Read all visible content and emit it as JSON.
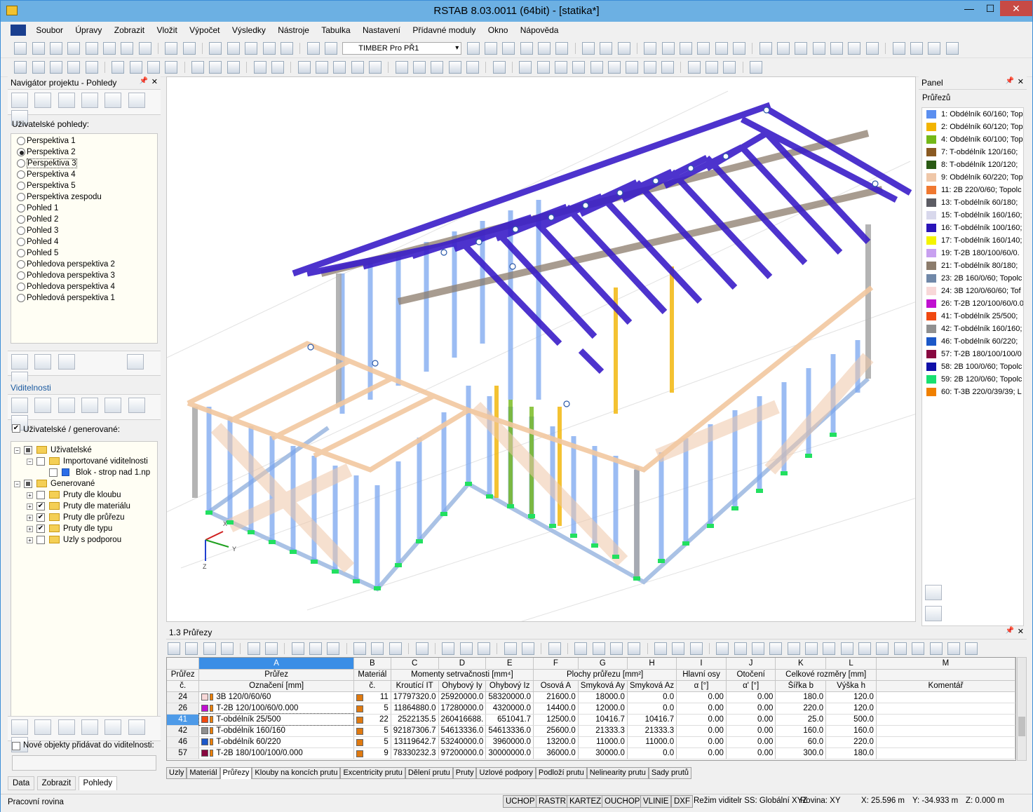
{
  "app": {
    "title": "RSTAB 8.03.0011 (64bit) - [statika*]"
  },
  "window_controls": {
    "minimize": "—",
    "maximize": "☐",
    "close": "✕"
  },
  "menu": [
    "Soubor",
    "Úpravy",
    "Zobrazit",
    "Vložit",
    "Výpočet",
    "Výsledky",
    "Nástroje",
    "Tabulka",
    "Nastavení",
    "Přídavné moduly",
    "Okno",
    "Nápověda"
  ],
  "toolbar": {
    "module_combo": "TIMBER Pro PŘ1"
  },
  "navigator": {
    "title": "Navigátor projektu - Pohledy",
    "user_views_label": "Uživatelské pohledy:",
    "views": [
      {
        "label": "Perspektiva 1",
        "checked": false
      },
      {
        "label": "Perspektiva 2",
        "checked": true
      },
      {
        "label": "Perspektiva 3",
        "checked": false,
        "focus": true
      },
      {
        "label": "Perspektiva 4",
        "checked": false
      },
      {
        "label": "Perspektiva 5",
        "checked": false
      },
      {
        "label": "Perspektiva zespodu",
        "checked": false
      },
      {
        "label": "Pohled 1",
        "checked": false
      },
      {
        "label": "Pohled 2",
        "checked": false
      },
      {
        "label": "Pohled 3",
        "checked": false
      },
      {
        "label": "Pohled 4",
        "checked": false
      },
      {
        "label": "Pohled 5",
        "checked": false
      },
      {
        "label": "Pohledova perspektiva 2",
        "checked": false
      },
      {
        "label": "Pohledova perspektiva 3",
        "checked": false
      },
      {
        "label": "Pohledova perspektiva 4",
        "checked": false
      },
      {
        "label": "Pohledová perspektiva 1",
        "checked": false
      }
    ],
    "visibility_title": "Viditelnosti",
    "visibility_check_label": "Uživatelské / generované:",
    "tree": [
      {
        "label": "Uživatelské",
        "level": 0,
        "exp": "−",
        "cb": "part",
        "icon": "folder"
      },
      {
        "label": "Importované viditelnosti",
        "level": 1,
        "exp": "−",
        "cb": "empty",
        "icon": "folder"
      },
      {
        "label": "Blok - strop nad 1.np",
        "level": 2,
        "exp": "",
        "cb": "empty",
        "icon": "block"
      },
      {
        "label": "Generované",
        "level": 0,
        "exp": "−",
        "cb": "part",
        "icon": "folder"
      },
      {
        "label": "Pruty dle kloubu",
        "level": 1,
        "exp": "+",
        "cb": "empty",
        "icon": "folder"
      },
      {
        "label": "Pruty dle materiálu",
        "level": 1,
        "exp": "+",
        "cb": "checked",
        "icon": "folder"
      },
      {
        "label": "Pruty dle průřezu",
        "level": 1,
        "exp": "+",
        "cb": "checked",
        "icon": "folder"
      },
      {
        "label": "Pruty dle typu",
        "level": 1,
        "exp": "+",
        "cb": "checked",
        "icon": "folder"
      },
      {
        "label": "Uzly s podporou",
        "level": 1,
        "exp": "+",
        "cb": "empty",
        "icon": "folder"
      }
    ],
    "new_objects_label": "Nové objekty přidávat do viditelnosti:",
    "tabs": [
      "Data",
      "Zobrazit",
      "Pohledy"
    ],
    "active_tab": "Pohledy"
  },
  "viewport": {
    "axes": {
      "x": "X",
      "y": "Y",
      "z": "Z"
    }
  },
  "panel": {
    "title": "Panel",
    "legend_title": "Průřezů",
    "items": [
      {
        "label": "1: Obdélník 60/160; Top",
        "color": "#5b8ff0"
      },
      {
        "label": "2: Obdélník 60/120; Top",
        "color": "#f2b400"
      },
      {
        "label": "4: Obdélník 60/100; Top",
        "color": "#74b818"
      },
      {
        "label": "7: T-obdélník 120/160; ",
        "color": "#8a5a22"
      },
      {
        "label": "8: T-obdélník 120/120; ",
        "color": "#2a5a14"
      },
      {
        "label": "9: Obdélník 60/220; Top",
        "color": "#efc7a8"
      },
      {
        "label": "11: 2B 220/0/60; Topolc",
        "color": "#f07830"
      },
      {
        "label": "13: T-obdélník 60/180; ",
        "color": "#5c5c64"
      },
      {
        "label": "15: T-obdélník 160/160;",
        "color": "#d8d8ec"
      },
      {
        "label": "16: T-obdélník 100/160;",
        "color": "#2a14b8"
      },
      {
        "label": "17: T-obdélník 160/140;",
        "color": "#f4f400"
      },
      {
        "label": "19: T-2B 180/100/60/0.",
        "color": "#c8a0f0"
      },
      {
        "label": "21: T-obdélník 80/180; ",
        "color": "#8c7c6c"
      },
      {
        "label": "23: 2B 160/0/60; Topolc",
        "color": "#7088a8"
      },
      {
        "label": "24: 3B 120/0/60/60; Tof",
        "color": "#f8d8d8"
      },
      {
        "label": "26: T-2B 120/100/60/0.0",
        "color": "#c010d0"
      },
      {
        "label": "41: T-obdélník 25/500; ",
        "color": "#f04810"
      },
      {
        "label": "42: T-obdélník 160/160;",
        "color": "#909090"
      },
      {
        "label": "46: T-obdélník 60/220; ",
        "color": "#1c58c8"
      },
      {
        "label": "57: T-2B 180/100/100/0",
        "color": "#880840"
      },
      {
        "label": "58: 2B 100/0/60; Topolc",
        "color": "#1010a8"
      },
      {
        "label": "59: 2B 120/0/60; Topolc",
        "color": "#18e070"
      },
      {
        "label": "60: T-3B 220/0/39/39; L",
        "color": "#f08000"
      }
    ]
  },
  "table": {
    "title": "1.3 Průřezy",
    "col_letters": [
      "A",
      "B",
      "C",
      "D",
      "E",
      "F",
      "G",
      "H",
      "I",
      "J",
      "K",
      "L",
      "M"
    ],
    "group_headers": {
      "rowh": "Průřez",
      "A": "Průřez",
      "B": "Materiál",
      "CDE": "Momenty setrvačnosti [mm⁴]",
      "FGH": "Plochy průřezu [mm²]",
      "I": "Hlavní osy",
      "J": "Otočení",
      "KL": "Celkové rozměry [mm]"
    },
    "sub_headers": {
      "rowh": "č.",
      "A": "Označení [mm]",
      "B": "č.",
      "C": "Kroutící IT",
      "D": "Ohybový Iy",
      "E": "Ohybový Iz",
      "F": "Osová A",
      "G": "Smyková Ay",
      "H": "Smyková Az",
      "I": "α [°]",
      "J": "α' [°]",
      "K": "Šířka b",
      "L": "Výška h",
      "M": "Komentář"
    },
    "rows": [
      {
        "no": "24",
        "name": "3B 120/0/60/60",
        "color": "#f8d8d8",
        "mat": "11",
        "It": "17797320.0",
        "Iy": "25920000.0",
        "Iz": "58320000.0",
        "A": "21600.0",
        "Ay": "18000.0",
        "Az": "0.0",
        "alpha": "0.00",
        "alpha2": "0.00",
        "b": "180.0",
        "h": "120.0",
        "comment": ""
      },
      {
        "no": "26",
        "name": "T-2B 120/100/60/0.000",
        "color": "#c010d0",
        "mat": "5",
        "It": "11864880.0",
        "Iy": "17280000.0",
        "Iz": "4320000.0",
        "A": "14400.0",
        "Ay": "12000.0",
        "Az": "0.0",
        "alpha": "0.00",
        "alpha2": "0.00",
        "b": "220.0",
        "h": "120.0",
        "comment": ""
      },
      {
        "no": "41",
        "name": "T-obdélník 25/500",
        "color": "#f04810",
        "mat": "22",
        "It": "2522135.5",
        "Iy": "260416688.",
        "Iz": "651041.7",
        "A": "12500.0",
        "Ay": "10416.7",
        "Az": "10416.7",
        "alpha": "0.00",
        "alpha2": "0.00",
        "b": "25.0",
        "h": "500.0",
        "comment": "",
        "selected": true
      },
      {
        "no": "42",
        "name": "T-obdélník 160/160",
        "color": "#909090",
        "mat": "5",
        "It": "92187306.7",
        "Iy": "54613336.0",
        "Iz": "54613336.0",
        "A": "25600.0",
        "Ay": "21333.3",
        "Az": "21333.3",
        "alpha": "0.00",
        "alpha2": "0.00",
        "b": "160.0",
        "h": "160.0",
        "comment": ""
      },
      {
        "no": "46",
        "name": "T-obdélník 60/220",
        "color": "#1c58c8",
        "mat": "5",
        "It": "13119642.7",
        "Iy": "53240000.0",
        "Iz": "3960000.0",
        "A": "13200.0",
        "Ay": "11000.0",
        "Az": "11000.0",
        "alpha": "0.00",
        "alpha2": "0.00",
        "b": "60.0",
        "h": "220.0",
        "comment": ""
      },
      {
        "no": "57",
        "name": "T-2B 180/100/100/0.000",
        "color": "#880840",
        "mat": "9",
        "It": "78330232.3",
        "Iy": "97200000.0",
        "Iz": "30000000.0",
        "A": "36000.0",
        "Ay": "30000.0",
        "Az": "0.0",
        "alpha": "0.00",
        "alpha2": "0.00",
        "b": "300.0",
        "h": "180.0",
        "comment": ""
      }
    ],
    "sheet_tabs": [
      "Uzly",
      "Materiál",
      "Průřezy",
      "Klouby na koncích prutu",
      "Excentricity prutu",
      "Dělení prutu",
      "Pruty",
      "Uzlové podpory",
      "Podloží prutu",
      "Nelinearity prutu",
      "Sady prutů"
    ],
    "active_sheet": "Průřezy"
  },
  "status": {
    "left": "Pracovní rovina",
    "buttons": [
      "UCHOP",
      "RASTR",
      "KARTEZ",
      "OUCHOP",
      "VLINIE",
      "DXF"
    ],
    "mode": "Režim viditelr SS: Globální XYZ",
    "plane": "Rovina: XY",
    "x": "X:  25.596 m",
    "y": "Y:  -34.933 m",
    "z": "Z:  0.000 m"
  },
  "colors": {
    "accent": "#6cb0e3",
    "selection": "#3a8ee6"
  }
}
